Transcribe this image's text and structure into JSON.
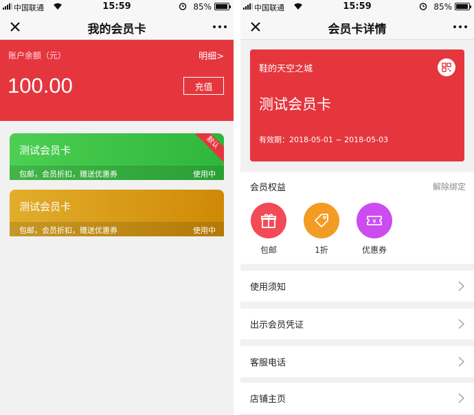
{
  "status_bar": {
    "carrier": "中国联通",
    "time": "15:59",
    "battery_pct": "85%",
    "battery_level": 0.85
  },
  "left": {
    "nav_title": "我的会员卡",
    "balance": {
      "label": "账户余额（元）",
      "detail_link": "明细>",
      "amount": "100.00",
      "recharge_label": "充值"
    },
    "cards": [
      {
        "name": "测试会员卡",
        "perks": "包邮，会员折扣，赠送优惠券",
        "status": "使用中",
        "badge": "默认",
        "color": "#3fc54a"
      },
      {
        "name": "测试会员卡",
        "perks": "包邮，会员折扣，赠送优惠券",
        "status": "使用中",
        "color": "#d99a18"
      }
    ]
  },
  "right": {
    "nav_title": "会员卡详情",
    "card": {
      "shop": "鞋的天空之城",
      "name": "测试会员卡",
      "validity": "有效期：2018-05-01 ~ 2018-05-03",
      "qr_icon": "qr-code-icon"
    },
    "benefits": {
      "title": "会员权益",
      "unbind": "解除绑定",
      "items": [
        {
          "label": "包邮",
          "icon": "gift-icon",
          "color": "#f24a57"
        },
        {
          "label": "1折",
          "icon": "tag-icon",
          "color": "#f29c24"
        },
        {
          "label": "优惠券",
          "icon": "coupon-icon",
          "color": "#cc4cf0"
        }
      ]
    },
    "menu": [
      "使用须知",
      "出示会员凭证",
      "客服电话",
      "店铺主页"
    ]
  },
  "colors": {
    "primary_red": "#e5363e",
    "background": "#f1f1f1"
  }
}
